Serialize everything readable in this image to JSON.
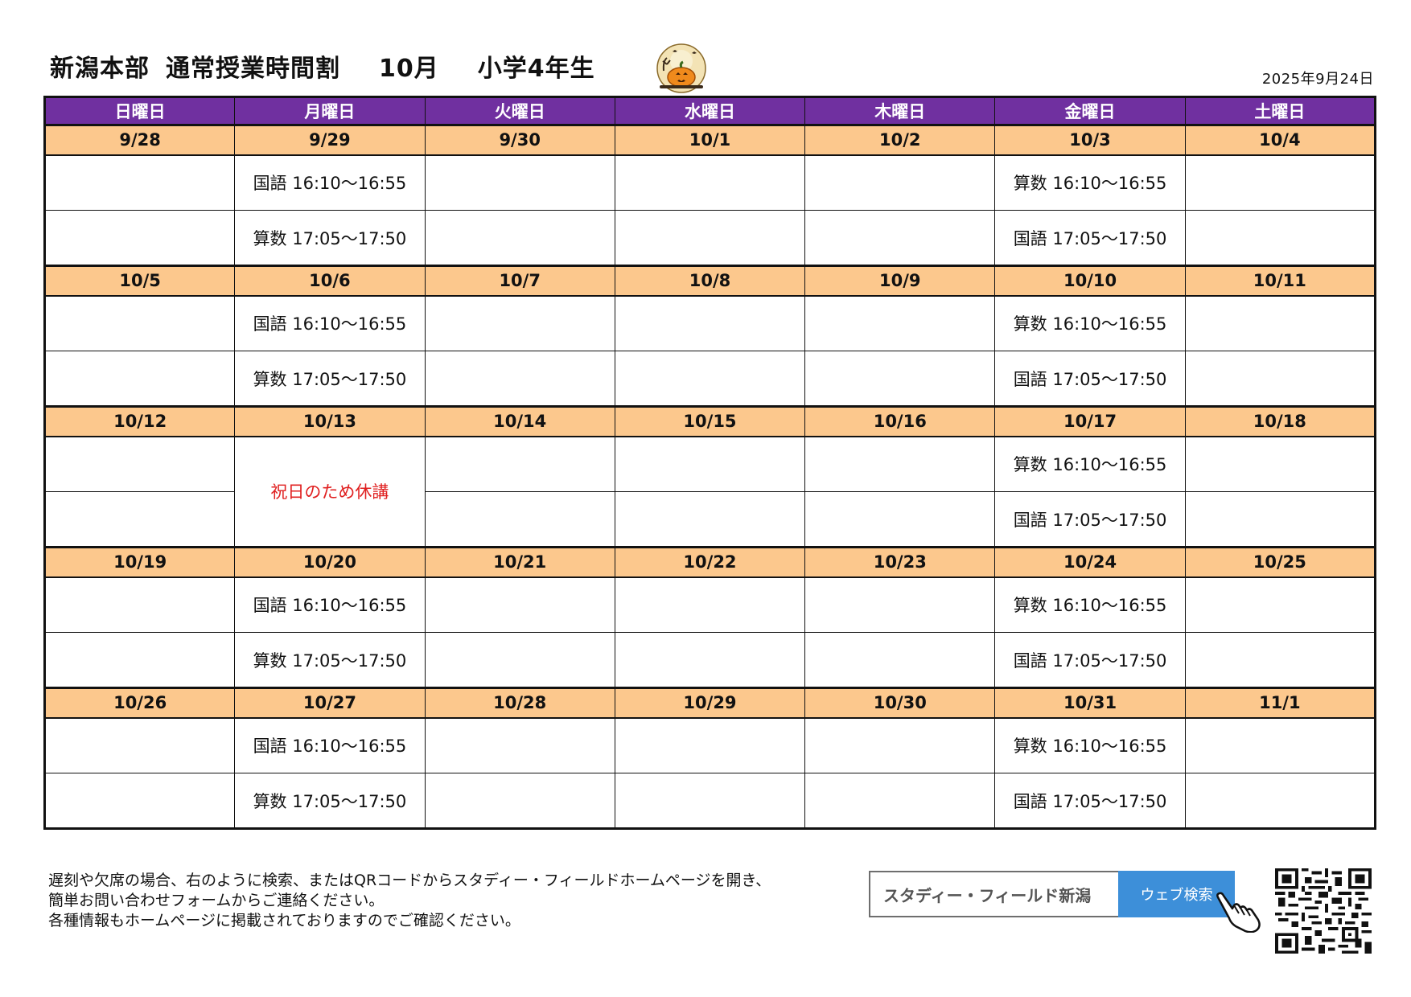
{
  "header": {
    "school": "新潟本部",
    "doc_title": "通常授業時間割",
    "month": "10月",
    "grade": "小学4年生",
    "issue_date": "2025年9月24日"
  },
  "weekdays": [
    "日曜日",
    "月曜日",
    "火曜日",
    "水曜日",
    "木曜日",
    "金曜日",
    "土曜日"
  ],
  "weeks": [
    {
      "dates": [
        "9/28",
        "9/29",
        "9/30",
        "10/1",
        "10/2",
        "10/3",
        "10/4"
      ],
      "slots": [
        [
          "",
          "国語 16:10～16:55",
          "",
          "",
          "",
          "算数 16:10～16:55",
          ""
        ],
        [
          "",
          "算数 17:05～17:50",
          "",
          "",
          "",
          "国語 17:05～17:50",
          ""
        ]
      ]
    },
    {
      "dates": [
        "10/5",
        "10/6",
        "10/7",
        "10/8",
        "10/9",
        "10/10",
        "10/11"
      ],
      "slots": [
        [
          "",
          "国語 16:10～16:55",
          "",
          "",
          "",
          "算数 16:10～16:55",
          ""
        ],
        [
          "",
          "算数 17:05～17:50",
          "",
          "",
          "",
          "国語 17:05～17:50",
          ""
        ]
      ]
    },
    {
      "dates": [
        "10/12",
        "10/13",
        "10/14",
        "10/15",
        "10/16",
        "10/17",
        "10/18"
      ],
      "holiday_note": "祝日のため休講",
      "slots": [
        [
          "",
          "",
          "",
          "",
          "",
          "算数 16:10～16:55",
          ""
        ],
        [
          "",
          "",
          "",
          "",
          "",
          "国語 17:05～17:50",
          ""
        ]
      ]
    },
    {
      "dates": [
        "10/19",
        "10/20",
        "10/21",
        "10/22",
        "10/23",
        "10/24",
        "10/25"
      ],
      "slots": [
        [
          "",
          "国語 16:10～16:55",
          "",
          "",
          "",
          "算数 16:10～16:55",
          ""
        ],
        [
          "",
          "算数 17:05～17:50",
          "",
          "",
          "",
          "国語 17:05～17:50",
          ""
        ]
      ]
    },
    {
      "dates": [
        "10/26",
        "10/27",
        "10/28",
        "10/29",
        "10/30",
        "10/31",
        "11/1"
      ],
      "slots": [
        [
          "",
          "国語 16:10～16:55",
          "",
          "",
          "",
          "算数 16:10～16:55",
          ""
        ],
        [
          "",
          "算数 17:05～17:50",
          "",
          "",
          "",
          "国語 17:05～17:50",
          ""
        ]
      ]
    }
  ],
  "notes": [
    "遅刻や欠席の場合、右のように検索、またはQRコードからスタディー・フィールドホームページを開き、",
    "簡単お問い合わせフォームからご連絡ください。",
    "各種情報もホームページに掲載されておりますのでご確認ください。"
  ],
  "search": {
    "query": "スタディー・フィールド新潟",
    "button": "ウェブ検索"
  },
  "colors": {
    "weekday_header": "#7030a0",
    "date_row": "#fcc88d",
    "holiday_text": "#e02020",
    "search_button": "#3d8fd9"
  },
  "icons": [
    "pumpkin-icon",
    "pointing-hand-icon",
    "qr-code"
  ]
}
